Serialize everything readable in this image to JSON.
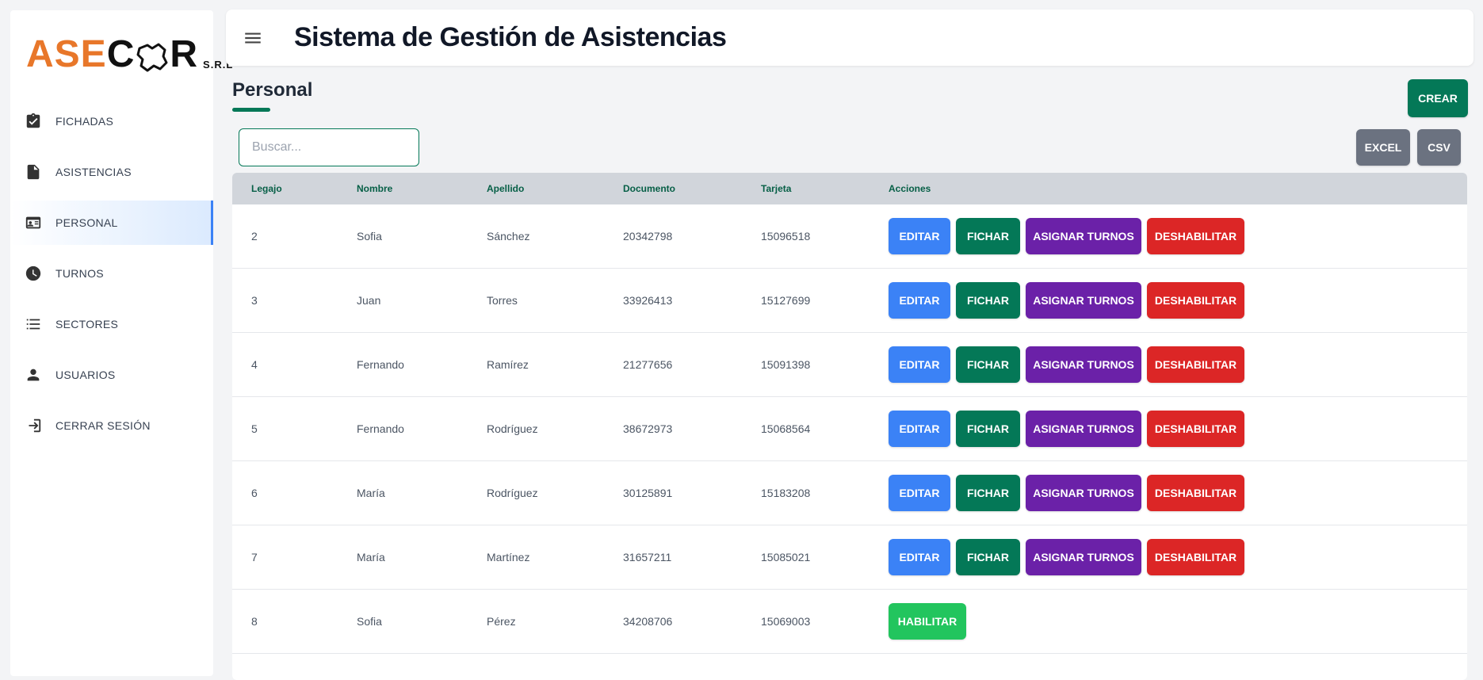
{
  "logo": {
    "part1": "ASE",
    "part2": "C",
    "part3": "R",
    "suffix": "S.R.L"
  },
  "sidebar": {
    "items": [
      {
        "label": "FICHADAS",
        "icon": "clipboard-check-icon"
      },
      {
        "label": "ASISTENCIAS",
        "icon": "file-icon"
      },
      {
        "label": "PERSONAL",
        "icon": "id-card-icon",
        "active": true
      },
      {
        "label": "TURNOS",
        "icon": "clock-icon"
      },
      {
        "label": "SECTORES",
        "icon": "list-icon"
      },
      {
        "label": "USUARIOS",
        "icon": "user-icon"
      },
      {
        "label": "CERRAR SESIÓN",
        "icon": "logout-icon"
      }
    ]
  },
  "header": {
    "title": "Sistema de Gestión de Asistencias"
  },
  "page": {
    "title": "Personal",
    "create_label": "CREAR",
    "excel_label": "EXCEL",
    "csv_label": "CSV",
    "search_placeholder": "Buscar..."
  },
  "table": {
    "headers": [
      "Legajo",
      "Nombre",
      "Apellido",
      "Documento",
      "Tarjeta",
      "Acciones"
    ],
    "action_labels": {
      "edit": "EDITAR",
      "fichar": "FICHAR",
      "turnos": "ASIGNAR TURNOS",
      "disable": "DESHABILITAR",
      "enable": "HABILITAR"
    },
    "rows": [
      {
        "legajo": "2",
        "nombre": "Sofia",
        "apellido": "Sánchez",
        "documento": "20342798",
        "tarjeta": "15096518",
        "enabled": true
      },
      {
        "legajo": "3",
        "nombre": "Juan",
        "apellido": "Torres",
        "documento": "33926413",
        "tarjeta": "15127699",
        "enabled": true
      },
      {
        "legajo": "4",
        "nombre": "Fernando",
        "apellido": "Ramírez",
        "documento": "21277656",
        "tarjeta": "15091398",
        "enabled": true
      },
      {
        "legajo": "5",
        "nombre": "Fernando",
        "apellido": "Rodríguez",
        "documento": "38672973",
        "tarjeta": "15068564",
        "enabled": true
      },
      {
        "legajo": "6",
        "nombre": "María",
        "apellido": "Rodríguez",
        "documento": "30125891",
        "tarjeta": "15183208",
        "enabled": true
      },
      {
        "legajo": "7",
        "nombre": "María",
        "apellido": "Martínez",
        "documento": "31657211",
        "tarjeta": "15085021",
        "enabled": true
      },
      {
        "legajo": "8",
        "nombre": "Sofia",
        "apellido": "Pérez",
        "documento": "34208706",
        "tarjeta": "15069003",
        "enabled": false
      }
    ]
  },
  "colors": {
    "primary_green": "#047857",
    "edit_blue": "#3b82f6",
    "assign_purple": "#6b21a8",
    "disable_red": "#dc2626",
    "enable_green": "#22c55e",
    "secondary_gray": "#6b7280",
    "logo_orange": "#e8772a"
  }
}
